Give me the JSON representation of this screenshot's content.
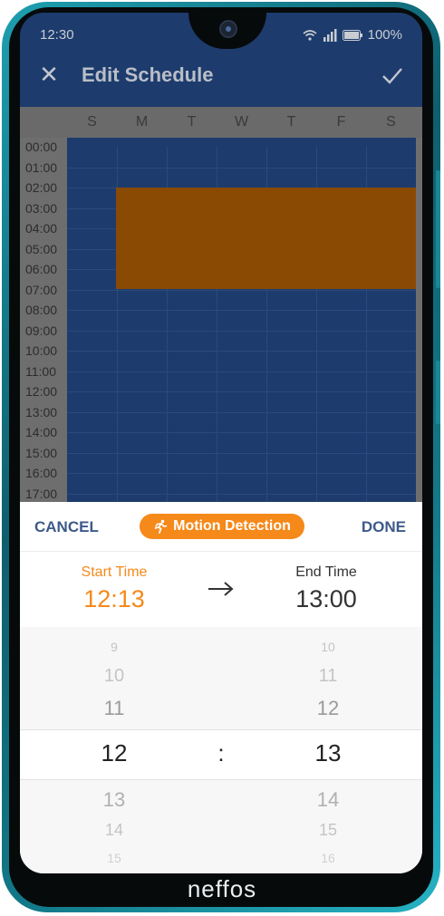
{
  "status_bar": {
    "time": "12:30",
    "battery": "100%"
  },
  "app_bar": {
    "title": "Edit Schedule",
    "close_icon": "close-icon",
    "confirm_icon": "check-icon"
  },
  "schedule": {
    "days": [
      "S",
      "M",
      "T",
      "W",
      "T",
      "F",
      "S"
    ],
    "hours": [
      "00:00",
      "01:00",
      "02:00",
      "03:00",
      "04:00",
      "05:00",
      "06:00",
      "07:00",
      "08:00",
      "09:00",
      "10:00",
      "11:00",
      "12:00",
      "13:00",
      "14:00",
      "15:00",
      "16:00",
      "17:00"
    ],
    "motion_block": {
      "days": [
        "M",
        "T",
        "W",
        "T",
        "F",
        "S"
      ],
      "start_hour": "02:00",
      "end_hour": "07:00",
      "color": "#8a4a04"
    },
    "grid_color": "#1d3c6d"
  },
  "sheet": {
    "cancel_label": "CANCEL",
    "done_label": "DONE",
    "mode_label": "Motion Detection",
    "mode_color": "#f5891a",
    "start_label": "Start Time",
    "start_value": "12:13",
    "end_label": "End Time",
    "end_value": "13:00",
    "separator": ":",
    "hour_wheel": [
      "9",
      "10",
      "11",
      "12",
      "13",
      "14",
      "15"
    ],
    "minute_wheel": [
      "10",
      "11",
      "12",
      "13",
      "14",
      "15",
      "16"
    ]
  },
  "brand": "neffos",
  "accent_color": "#3d5a8a"
}
